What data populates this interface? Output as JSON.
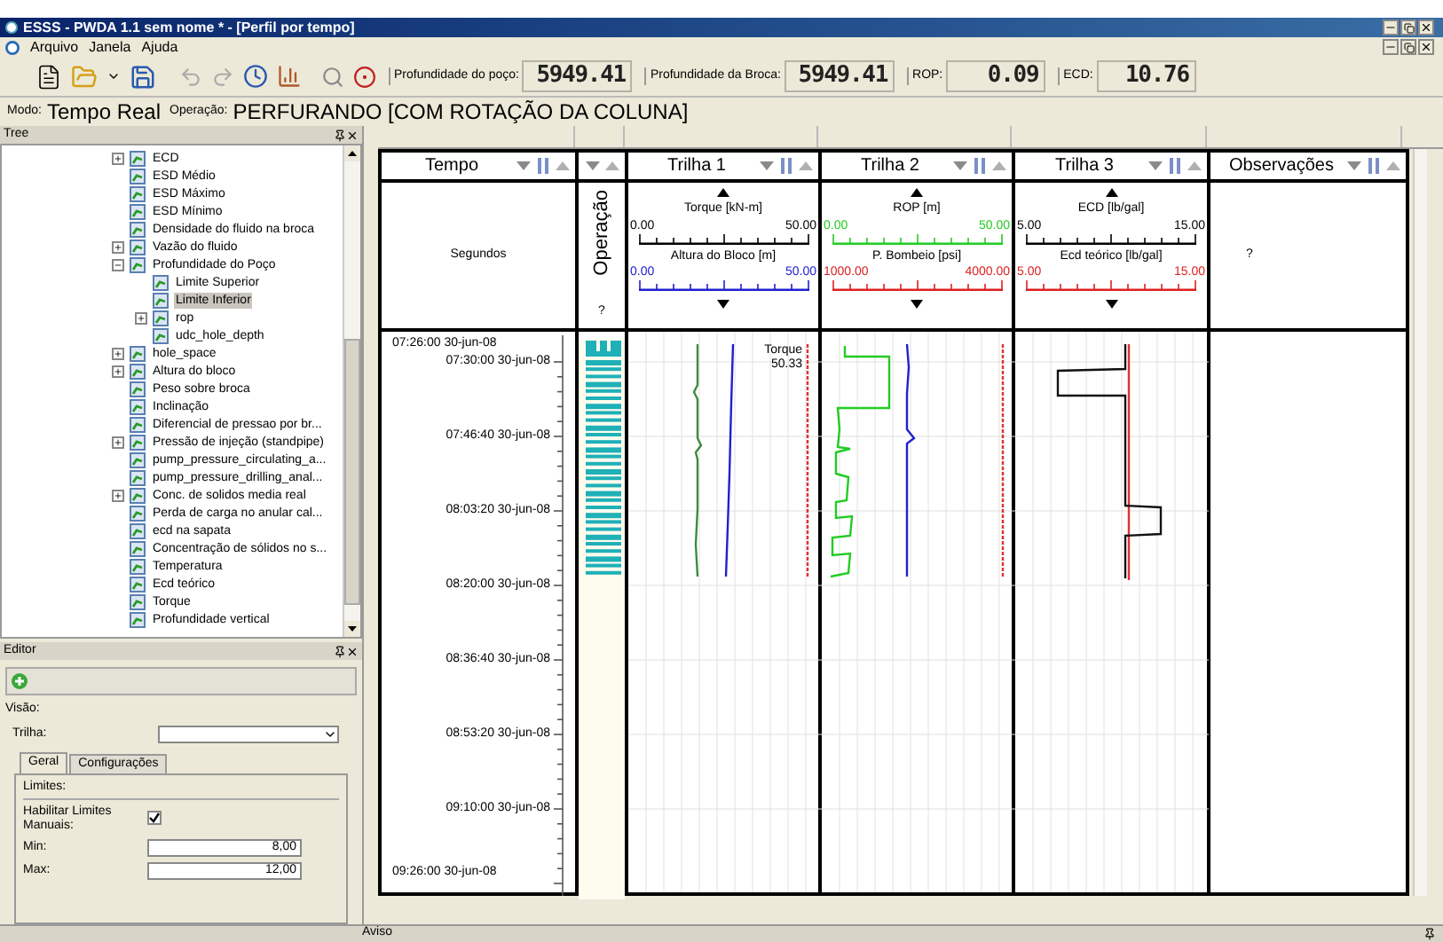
{
  "window": {
    "title": "ESSS - PWDA 1.1 sem nome * - [Perfil por tempo]"
  },
  "menu": [
    "Arquivo",
    "Janela",
    "Ajuda"
  ],
  "toolbar": {
    "readouts": [
      {
        "label": "Profundidade do poço:",
        "value": "5949.41"
      },
      {
        "label": "Profundidade da Broca:",
        "value": "5949.41"
      },
      {
        "label": "ROP:",
        "value": "0.09"
      },
      {
        "label": "ECD:",
        "value": "10.76"
      }
    ]
  },
  "mode_bar": {
    "mode_label": "Modo:",
    "mode": "Tempo Real",
    "operation_label": "Operação:",
    "operation": "PERFURANDO [COM ROTAÇÃO DA COLUNA]"
  },
  "tree": {
    "title": "Tree",
    "items": [
      {
        "label": "ECD",
        "kind": "group",
        "expanded": false,
        "selected": false
      },
      {
        "label": "ESD Médio",
        "kind": "leaf",
        "selected": false
      },
      {
        "label": "ESD Máximo",
        "kind": "leaf",
        "selected": false
      },
      {
        "label": "ESD Mínimo",
        "kind": "leaf",
        "selected": false
      },
      {
        "label": "Densidade do fluido na broca",
        "kind": "leaf",
        "selected": false
      },
      {
        "label": "Vazão do fluido",
        "kind": "group",
        "expanded": false,
        "selected": false
      },
      {
        "label": "Profundidade do Poço",
        "kind": "group",
        "expanded": true,
        "selected": false,
        "children": [
          {
            "label": "Limite Superior",
            "kind": "leaf",
            "selected": false
          },
          {
            "label": "Limite Inferior",
            "kind": "leaf",
            "selected": true
          },
          {
            "label": "rop",
            "kind": "group",
            "expanded": false,
            "selected": false
          },
          {
            "label": "udc_hole_depth",
            "kind": "leaf",
            "selected": false
          }
        ]
      },
      {
        "label": "hole_space",
        "kind": "group",
        "expanded": false,
        "selected": false
      },
      {
        "label": "Altura do bloco",
        "kind": "group",
        "expanded": false,
        "selected": false
      },
      {
        "label": "Peso sobre broca",
        "kind": "leaf",
        "selected": false
      },
      {
        "label": "Inclinação",
        "kind": "leaf",
        "selected": false
      },
      {
        "label": "Diferencial de pressao por br...",
        "kind": "leaf",
        "selected": false
      },
      {
        "label": "Pressão de injeção (standpipe)",
        "kind": "group",
        "expanded": false,
        "selected": false
      },
      {
        "label": "pump_pressure_circulating_a...",
        "kind": "leaf",
        "selected": false
      },
      {
        "label": "pump_pressure_drilling_anal...",
        "kind": "leaf",
        "selected": false
      },
      {
        "label": "Conc. de solidos media real",
        "kind": "group",
        "expanded": false,
        "selected": false
      },
      {
        "label": "Perda de carga no anular cal...",
        "kind": "leaf",
        "selected": false
      },
      {
        "label": "ecd na sapata",
        "kind": "leaf",
        "selected": false
      },
      {
        "label": "Concentração de sólidos no s...",
        "kind": "leaf",
        "selected": false
      },
      {
        "label": "Temperatura",
        "kind": "leaf",
        "selected": false
      },
      {
        "label": "Ecd teórico",
        "kind": "leaf",
        "selected": false
      },
      {
        "label": "Torque",
        "kind": "leaf",
        "selected": false
      },
      {
        "label": "Profundidade vertical",
        "kind": "leaf",
        "selected": false
      }
    ]
  },
  "editor": {
    "title": "Editor",
    "view_label": "Visão:",
    "track_label": "Trilha:",
    "tabs": [
      {
        "label": "Geral",
        "selected": true
      },
      {
        "label": "Configurações",
        "selected": false
      }
    ],
    "group_label": "Limites:",
    "manual_limits": {
      "label": "Habilitar Limites Manuais:",
      "checked": true
    },
    "min": {
      "label": "Min:",
      "value": "8,00"
    },
    "max": {
      "label": "Max:",
      "value": "12,00"
    }
  },
  "log": {
    "columns": [
      {
        "kind": "time",
        "title": "Tempo",
        "unit": "Segundos"
      },
      {
        "kind": "operation",
        "title": "Operação",
        "note": "?"
      },
      {
        "kind": "track",
        "title": "Trilha 1",
        "readout": {
          "name": "Torque",
          "value": "50.33"
        },
        "curves": [
          {
            "name": "Torque [kN-m]",
            "min": "0.00",
            "max": "50.00",
            "color": "#000000"
          },
          {
            "name": "Altura do Bloco [m]",
            "min": "0.00",
            "max": "50.00",
            "color": "#2020d0"
          }
        ]
      },
      {
        "kind": "track",
        "title": "Trilha 2",
        "curves": [
          {
            "name": "ROP [m]",
            "min": "0.00",
            "max": "50.00",
            "color": "#22cc22"
          },
          {
            "name": "P. Bombeio [psi]",
            "min": "1000.00",
            "max": "4000.00",
            "color": "#dd2020"
          }
        ]
      },
      {
        "kind": "track",
        "title": "Trilha 3",
        "curves": [
          {
            "name": "ECD [lb/gal]",
            "min": "5.00",
            "max": "15.00",
            "color": "#000000"
          },
          {
            "name": "Ecd teórico [lb/gal]",
            "min": "5.00",
            "max": "15.00",
            "color": "#dd2020"
          }
        ]
      },
      {
        "kind": "notes",
        "title": "Observações",
        "note": "?"
      }
    ],
    "time_labels": [
      {
        "kind": "start",
        "text": "07:26:00 30-jun-08"
      },
      {
        "kind": "tick",
        "text": "07:30:00 30-jun-08"
      },
      {
        "kind": "tick",
        "text": "07:46:40 30-jun-08"
      },
      {
        "kind": "tick",
        "text": "08:03:20 30-jun-08"
      },
      {
        "kind": "tick",
        "text": "08:20:00 30-jun-08"
      },
      {
        "kind": "tick",
        "text": "08:36:40 30-jun-08"
      },
      {
        "kind": "tick",
        "text": "08:53:20 30-jun-08"
      },
      {
        "kind": "tick",
        "text": "09:10:00 30-jun-08"
      },
      {
        "kind": "end",
        "text": "09:26:00 30-jun-08"
      }
    ]
  },
  "status_bar": {
    "title": "Aviso"
  }
}
